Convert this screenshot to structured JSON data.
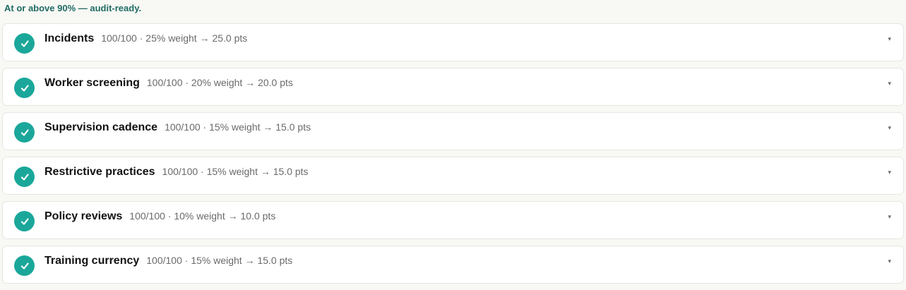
{
  "banner": "At or above 90% — audit-ready.",
  "items": [
    {
      "title": "Incidents",
      "meta": "100/100 · 25% weight → 25.0 pts"
    },
    {
      "title": "Worker screening",
      "meta": "100/100 · 20% weight → 20.0 pts"
    },
    {
      "title": "Supervision cadence",
      "meta": "100/100 · 15% weight → 15.0 pts"
    },
    {
      "title": "Restrictive practices",
      "meta": "100/100 · 15% weight → 15.0 pts"
    },
    {
      "title": "Policy reviews",
      "meta": "100/100 · 10% weight → 10.0 pts"
    },
    {
      "title": "Training currency",
      "meta": "100/100 · 15% weight → 15.0 pts"
    }
  ],
  "chevron": "▾",
  "status_icon": "check-circle-icon",
  "accent_color": "#1aa79a",
  "banner_color": "#1f6b63"
}
